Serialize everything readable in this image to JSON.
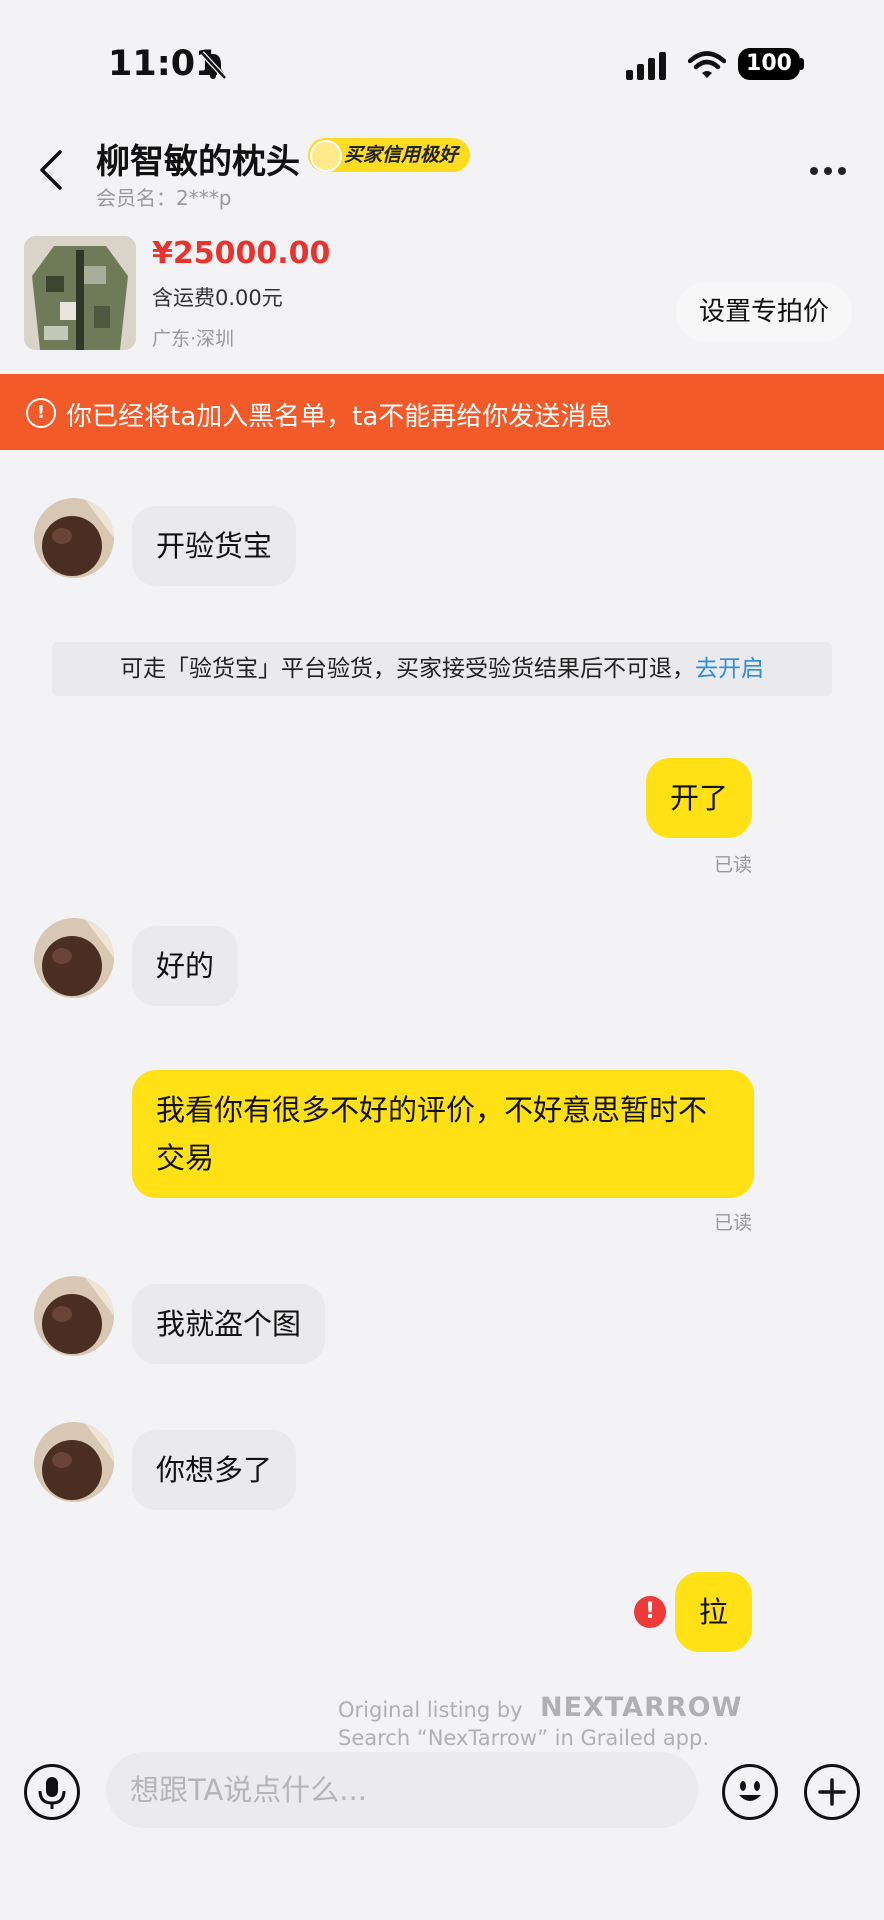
{
  "status_bar": {
    "time": "11:01",
    "battery": "100"
  },
  "header": {
    "title": "柳智敏的枕头",
    "badge": "买家信用极好",
    "member": "会员名：2***p"
  },
  "product": {
    "price": "¥25000.00",
    "shipping": "含运费0.00元",
    "location": "广东·深圳",
    "set_price_button": "设置专拍价"
  },
  "banner": {
    "icon": "!",
    "text": "你已经将ta加入黑名单，ta不能再给你发送消息"
  },
  "messages": [
    {
      "side": "in",
      "text": "开验货宝"
    },
    {
      "side": "out",
      "text": "开了",
      "status": "已读"
    },
    {
      "side": "in",
      "text": "好的"
    },
    {
      "side": "out",
      "text": "我看你有很多不好的评价，不好意思暂时不交易",
      "status": "已读"
    },
    {
      "side": "in",
      "text": "我就盗个图"
    },
    {
      "side": "in",
      "text": "你想多了"
    },
    {
      "side": "out",
      "text": "拉",
      "error": true
    }
  ],
  "system_notice": {
    "text": "可走「验货宝」平台验货，买家接受验货结果后不可退，",
    "link": "去开启"
  },
  "error_icon": "!",
  "watermark": {
    "line1": "Original listing by",
    "logo": "NEXTARROW",
    "line2": "Search “NexTarrow” in Grailed app."
  },
  "input_bar": {
    "placeholder": "想跟TA说点什么..."
  },
  "colors": {
    "banner": "#f35a29",
    "outgoing_bubble": "#ffe116",
    "incoming_bubble": "#eaeaec",
    "price": "#e8332f",
    "link": "#2d8edb",
    "badge": "#ffdc1f"
  }
}
